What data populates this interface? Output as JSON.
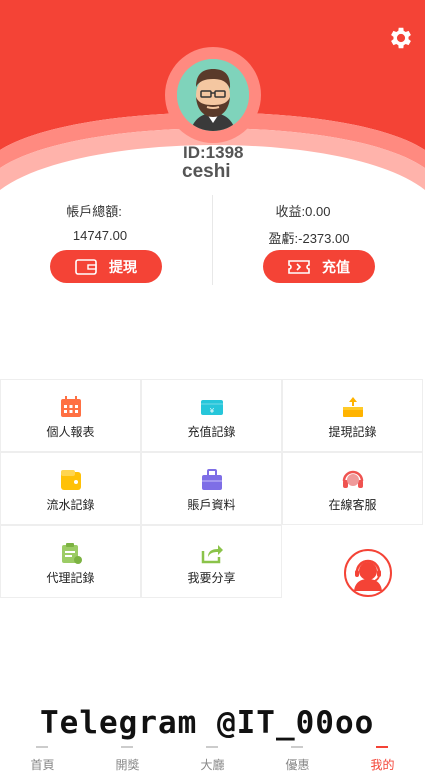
{
  "user": {
    "id_text": "ID:1398",
    "name": "ceshi"
  },
  "balance": {
    "total_label": "帳戶總額:",
    "total_value": "14747.00",
    "income_label": "收益:",
    "income_value": "0.00",
    "profit_label": "盈虧:",
    "profit_value": "-2373.00",
    "withdraw_label": "提現",
    "recharge_label": "充值"
  },
  "menu": [
    {
      "label": "個人報表",
      "icon": "calendar-report-icon",
      "color": "#ff7043"
    },
    {
      "label": "充值記錄",
      "icon": "recharge-card-icon",
      "color": "#26c6da"
    },
    {
      "label": "提現記錄",
      "icon": "withdraw-tray-icon",
      "color": "#ffb300"
    },
    {
      "label": "流水記錄",
      "icon": "wallet-icon",
      "color": "#ffc107"
    },
    {
      "label": "賬戶資料",
      "icon": "account-briefcase-icon",
      "color": "#7e6ee6"
    },
    {
      "label": "在線客服",
      "icon": "headset-icon",
      "color": "#ef5350"
    },
    {
      "label": "代理記錄",
      "icon": "agent-clipboard-icon",
      "color": "#9ccc65"
    },
    {
      "label": "我要分享",
      "icon": "share-icon",
      "color": "#8bc34a"
    }
  ],
  "watermark": "Telegram @IT_00oo",
  "tabs": [
    {
      "label": "首頁"
    },
    {
      "label": "開獎"
    },
    {
      "label": "大廳"
    },
    {
      "label": "優惠"
    },
    {
      "label": "我的",
      "active": true
    }
  ],
  "colors": {
    "accent": "#f44336",
    "header_light": "#ff8a80"
  }
}
